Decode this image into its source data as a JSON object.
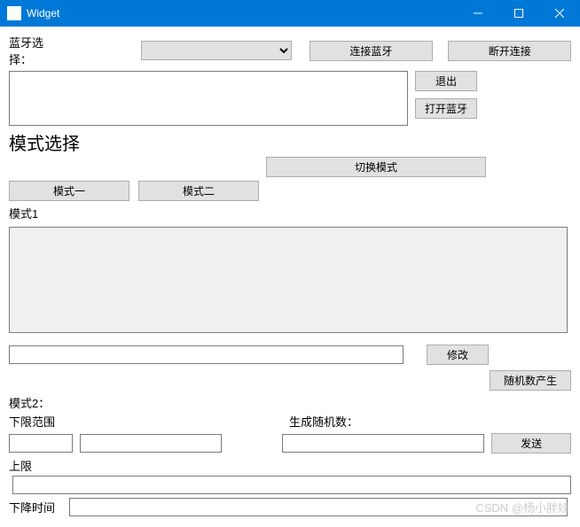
{
  "window": {
    "title": "Widget"
  },
  "bluetooth": {
    "select_label": "蓝牙选择：",
    "connect": "连接蓝牙",
    "disconnect": "断开连接",
    "exit": "退出",
    "open": "打开蓝牙"
  },
  "mode": {
    "heading": "模式选择",
    "mode1_btn": "模式一",
    "mode2_btn": "模式二",
    "switch": "切换模式",
    "mode1_label": "模式1",
    "modify": "修改",
    "random_gen": "随机数产生",
    "mode2_label": "模式2：",
    "lower_range": "下限范围",
    "gen_random": "生成随机数：",
    "send": "发送",
    "upper": "上限",
    "drop_time": "下降时间"
  },
  "watermark": "CSDN @杨小胖娃"
}
